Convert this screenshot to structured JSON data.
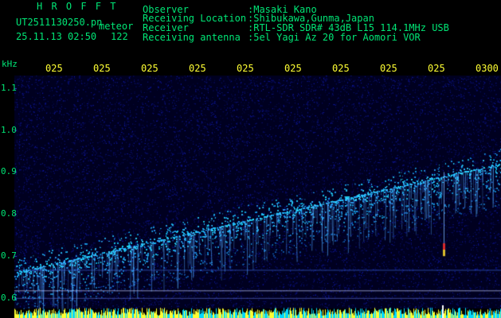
{
  "header": {
    "brand": "H R O F F T",
    "filename": "UT2511130250.pn",
    "mode": "meteor",
    "datetime": "25.11.13 02:50",
    "count": "122",
    "labels": {
      "observer": "Observer",
      "location": "Receiving Location",
      "receiver": "Receiver",
      "antenna": "Receiving antenna"
    },
    "values": {
      "observer": ":Masaki Kano",
      "location": ":Shibukawa,Gunma,Japan",
      "receiver": ":RTL-SDR SDR# 43dB L15 114.1MHz USB",
      "antenna": ":5el Yagi Az 20 for Aomori VOR"
    }
  },
  "spectrogram": {
    "y_unit": "kHz",
    "y_ticks": [
      "1.1",
      "1.0",
      "0.9",
      "0.8",
      "0.7",
      "0.6"
    ],
    "y_values": [
      1.1,
      1.0,
      0.9,
      0.8,
      0.7,
      0.6
    ],
    "y_range": [
      0.6,
      1.1
    ],
    "time_ticks": [
      "025",
      "025",
      "025",
      "025",
      "025",
      "025",
      "025",
      "025",
      "025",
      "0300"
    ],
    "colors": {
      "background": "#000020",
      "text": "#00e676",
      "time_labels": "#ffff33",
      "grid": "#3a3ad8"
    }
  }
}
